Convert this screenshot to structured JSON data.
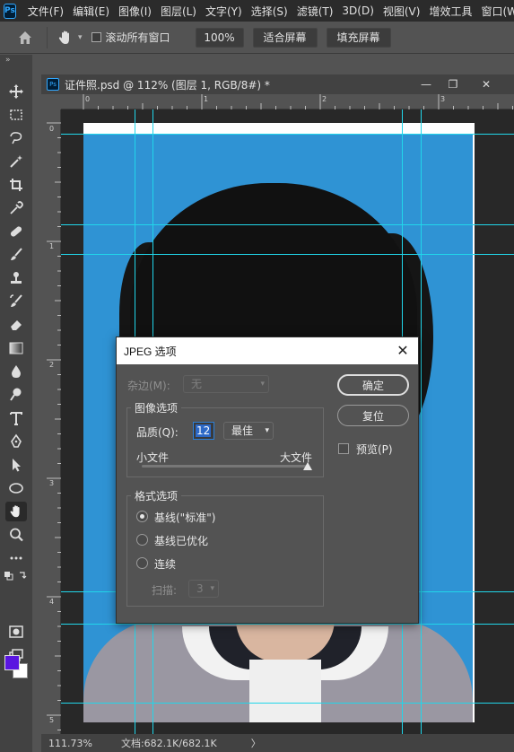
{
  "app": {
    "logo": "Ps"
  },
  "menu": [
    "文件(F)",
    "编辑(E)",
    "图像(I)",
    "图层(L)",
    "文字(Y)",
    "选择(S)",
    "滤镜(T)",
    "3D(D)",
    "视图(V)",
    "增效工具",
    "窗口(W)"
  ],
  "options": {
    "scroll_all_label": "滚动所有窗口",
    "zoom_value": "100%",
    "fit_screen": "适合屏幕",
    "fill_screen": "填充屏幕"
  },
  "toolbar": {
    "collapse": "»"
  },
  "document": {
    "logo": "Ps",
    "title": "证件照.psd @ 112% (图层 1, RGB/8#) *",
    "minimize": "—",
    "restore": "❐",
    "close": "✕",
    "ruler_h": [
      "0",
      "1",
      "2",
      "3"
    ],
    "ruler_v": [
      "0",
      "1",
      "2",
      "3",
      "4",
      "5"
    ]
  },
  "status": {
    "zoom": "111.73%",
    "doc_size": "文档:682.1K/682.1K",
    "arrow": "〉"
  },
  "colors": {
    "foreground": "#5a16e0",
    "background": "#ffffff",
    "guides": "#21d6ea"
  },
  "dialog": {
    "title": "JPEG 选项",
    "close": "✕",
    "matte_label": "杂边(M):",
    "matte_value": "无",
    "image_options_title": "图像选项",
    "quality_label": "品质(Q):",
    "quality_value": "12",
    "quality_preset": "最佳",
    "small_file": "小文件",
    "large_file": "大文件",
    "quality_slider_fraction": 1.0,
    "format_options_title": "格式选项",
    "format_options": [
      "基线(\"标准\")",
      "基线已优化",
      "连续"
    ],
    "format_selected": 0,
    "scans_label": "扫描:",
    "scans_value": "3",
    "ok_button": "确定",
    "reset_button": "复位",
    "preview_label": "预览(P)"
  }
}
